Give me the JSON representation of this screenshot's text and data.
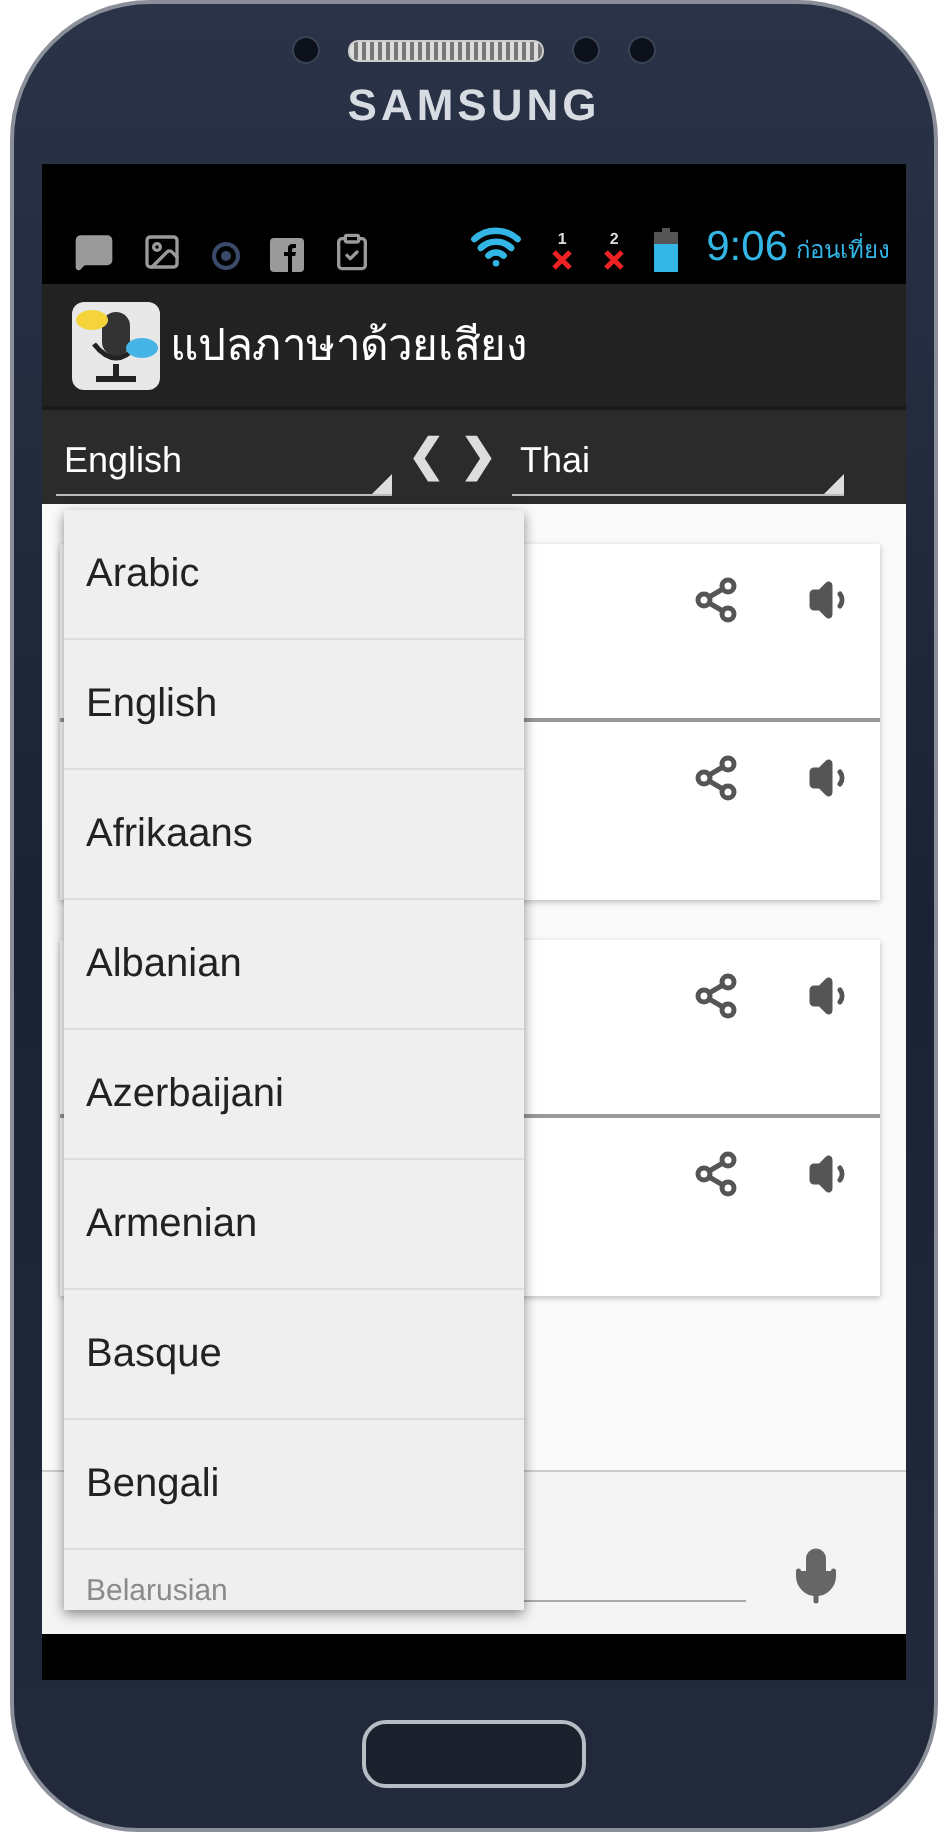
{
  "device": {
    "brand": "SAMSUNG"
  },
  "status_bar": {
    "sim_slots": [
      {
        "label": "1"
      },
      {
        "label": "2"
      }
    ],
    "time": "9:06",
    "period": "ก่อนเที่ยง"
  },
  "app_bar": {
    "title": "แปลภาษาด้วยเสียง"
  },
  "languages": {
    "source": "English",
    "swap": [
      "❮",
      "❯"
    ],
    "target": "Thai"
  },
  "dropdown": {
    "options": [
      {
        "label": "Arabic",
        "kind": "option"
      },
      {
        "label": "English",
        "kind": "option"
      },
      {
        "label": "Afrikaans",
        "kind": "option"
      },
      {
        "label": "Albanian",
        "kind": "option"
      },
      {
        "label": "Azerbaijani",
        "kind": "option"
      },
      {
        "label": "Armenian",
        "kind": "option"
      },
      {
        "label": "Basque",
        "kind": "option"
      },
      {
        "label": "Bengali",
        "kind": "option"
      },
      {
        "label": "Belarusian",
        "kind": "partial"
      }
    ]
  }
}
